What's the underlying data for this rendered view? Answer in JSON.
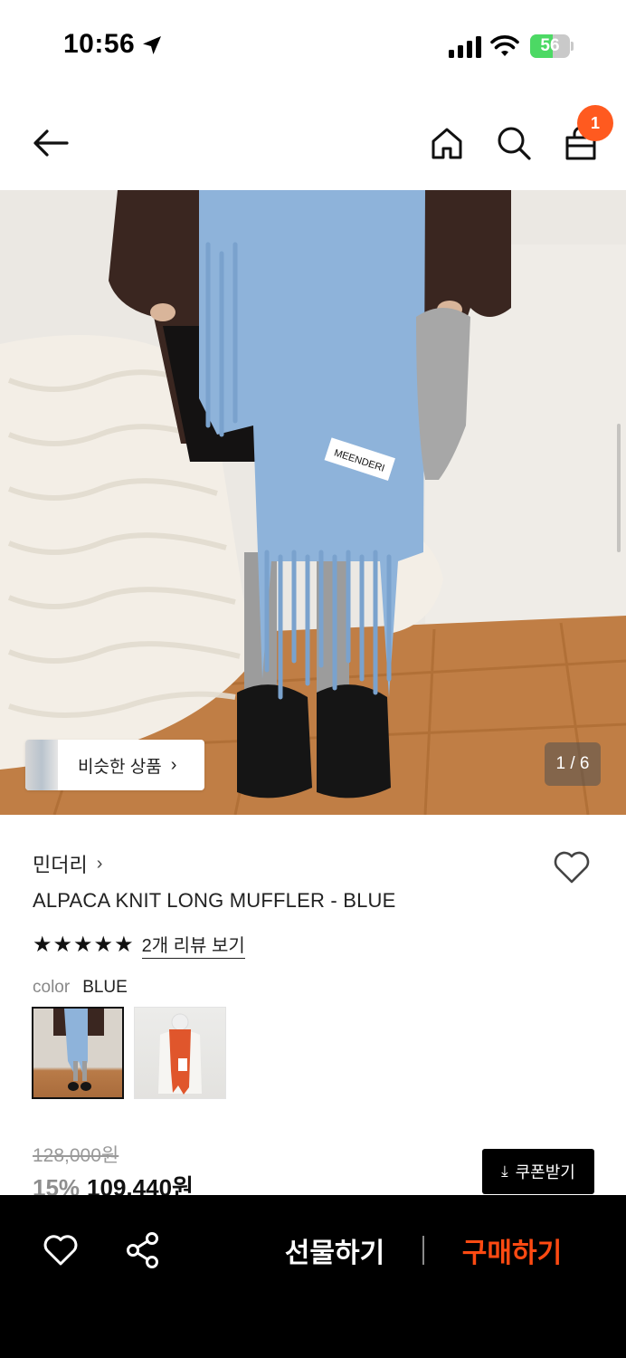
{
  "status_bar": {
    "time": "10:56",
    "battery_level": 56,
    "battery_label": "56",
    "icons": [
      "location-arrow-icon",
      "cellular-signal-icon",
      "wifi-icon",
      "battery-charging-icon"
    ]
  },
  "nav": {
    "icons": [
      "back-arrow-icon",
      "home-icon",
      "search-icon",
      "shopping-bag-icon"
    ],
    "cart_count": "1"
  },
  "gallery": {
    "similar_products_label": "비슷한 상품",
    "similar_chevron": "›",
    "page_indicator": "1 / 6",
    "scarf_tag_text": "MEENDERI"
  },
  "product": {
    "brand": "민더리",
    "brand_chevron": "›",
    "title": "ALPACA KNIT LONG MUFFLER - BLUE",
    "rating_stars": 5,
    "star_glyphs": [
      "★",
      "★",
      "★",
      "★",
      "★"
    ],
    "review_link": "2개 리뷰 보기",
    "color_label": "color",
    "color_value": "BLUE",
    "swatches": [
      "blue-muffler-swatch",
      "orange-muffler-swatch"
    ],
    "original_price": "128,000원",
    "discount": "15%",
    "sale_price": "109,440원",
    "coupon_label": "쿠폰받기",
    "coupon_icon": "⤓"
  },
  "bottom_bar": {
    "gift_label": "선물하기",
    "buy_label": "구매하기"
  },
  "colors": {
    "accent_orange": "#FF4A12",
    "badge_orange": "#FF5A1F",
    "muffler_blue": "#8EB3DA",
    "bottom_bar_bg": "#000000"
  }
}
